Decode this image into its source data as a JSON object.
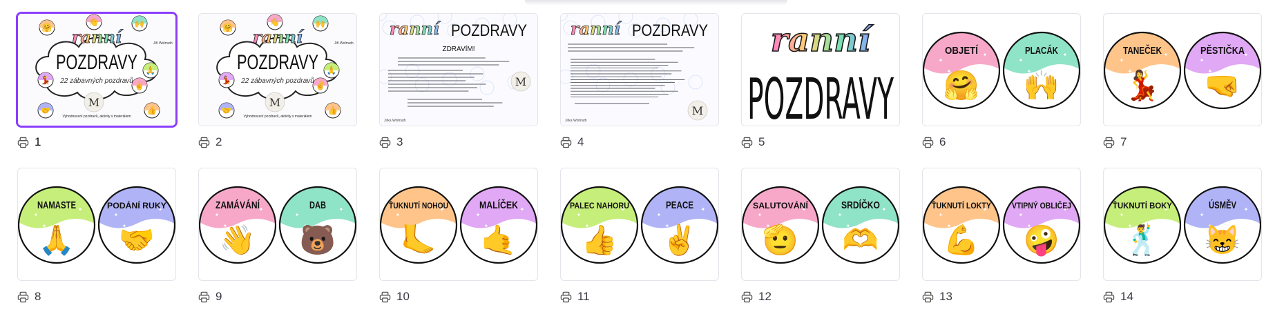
{
  "accent_color": "#8b3dff",
  "pages": [
    {
      "number": "1",
      "selected": true,
      "kind": "title-cloud",
      "title_script": "ranní",
      "title_main": "POZDRAVY",
      "subtitle": "22 zábavných pozdravů",
      "bottom_text": "Vyhodnocení pozdravů, aktivity s materiálem",
      "credit": "Jiří Wolmuth"
    },
    {
      "number": "2",
      "selected": false,
      "kind": "title-cloud",
      "title_script": "ranní",
      "title_main": "POZDRAVY",
      "subtitle": "22 zábavných pozdravů",
      "bottom_text": "Vyhodnocení pozdravů, aktivity s materiálem",
      "credit": "Jiří Wolmuth"
    },
    {
      "number": "3",
      "selected": false,
      "kind": "text-intro",
      "title_script": "ranní",
      "title_main": "POZDRAVY",
      "heading": "ZDRAVÍM!",
      "footer": "Jirka Wolmuth",
      "icon": "print-icon"
    },
    {
      "number": "4",
      "selected": false,
      "kind": "text-dense",
      "title_script": "ranní",
      "title_main": "POZDRAVY",
      "footer": "Jirka Wolmuth"
    },
    {
      "number": "5",
      "selected": false,
      "kind": "cover",
      "title_script": "ranní",
      "title_main": "POZDRAVY"
    },
    {
      "number": "6",
      "selected": false,
      "kind": "cards",
      "left": {
        "label": "OBJETÍ",
        "color": "#f7a8c8",
        "emoji": "🤗"
      },
      "right": {
        "label": "PLACÁK",
        "color": "#8fe3c6",
        "emoji": "🙌"
      }
    },
    {
      "number": "7",
      "selected": false,
      "kind": "cards",
      "left": {
        "label": "TANEČEK",
        "color": "#ffc48a",
        "emoji": "💃"
      },
      "right": {
        "label": "PĚSTIČKA",
        "color": "#e0a8f5",
        "emoji": "🤜"
      }
    },
    {
      "number": "8",
      "selected": false,
      "kind": "cards",
      "left": {
        "label": "NAMASTE",
        "color": "#c6ee7a",
        "emoji": "🙏"
      },
      "right": {
        "label": "PODÁNÍ RUKY",
        "color": "#b0b4f7",
        "emoji": "🤝"
      }
    },
    {
      "number": "9",
      "selected": false,
      "kind": "cards",
      "left": {
        "label": "ZAMÁVÁNÍ",
        "color": "#f7a8c8",
        "emoji": "👋"
      },
      "right": {
        "label": "DAB",
        "color": "#8fe3c6",
        "emoji": "🐻"
      }
    },
    {
      "number": "10",
      "selected": false,
      "kind": "cards",
      "left": {
        "label": "ŤUKNUTÍ NOHOU",
        "color": "#ffc48a",
        "emoji": "🦶"
      },
      "right": {
        "label": "MALÍČEK",
        "color": "#e0a8f5",
        "emoji": "🤙"
      }
    },
    {
      "number": "11",
      "selected": false,
      "kind": "cards",
      "left": {
        "label": "PALEC NAHORU",
        "color": "#c6ee7a",
        "emoji": "👍"
      },
      "right": {
        "label": "PEACE",
        "color": "#b0b4f7",
        "emoji": "✌"
      }
    },
    {
      "number": "12",
      "selected": false,
      "kind": "cards",
      "left": {
        "label": "SALUTOVÁNÍ",
        "color": "#f7a8c8",
        "emoji": "🫡"
      },
      "right": {
        "label": "SRDÍČKO",
        "color": "#8fe3c6",
        "emoji": "🫶"
      }
    },
    {
      "number": "13",
      "selected": false,
      "kind": "cards",
      "left": {
        "label": "ŤUKNUTÍ LOKTY",
        "color": "#ffc48a",
        "emoji": "💪"
      },
      "right": {
        "label": "VTIPNÝ OBLIČEJ",
        "color": "#e0a8f5",
        "emoji": "🤪"
      }
    },
    {
      "number": "14",
      "selected": false,
      "kind": "cards",
      "left": {
        "label": "ŤUKNUTÍ BOKY",
        "color": "#c6ee7a",
        "emoji": "🕺"
      },
      "right": {
        "label": "ÚSMĚV",
        "color": "#b0b4f7",
        "emoji": "😸"
      }
    }
  ]
}
